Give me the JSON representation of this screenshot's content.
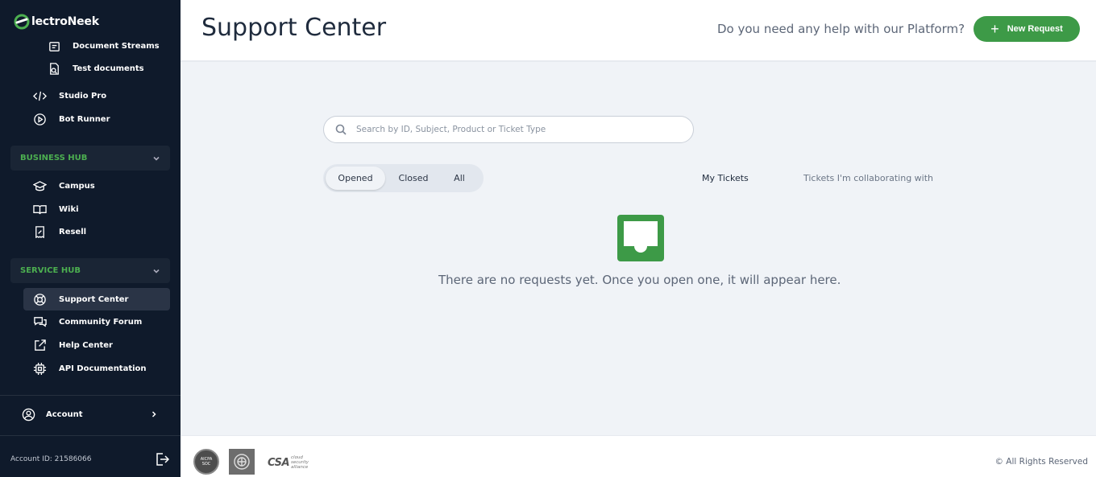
{
  "brand": {
    "logo_text": "lectroNeek",
    "accent": "#3d9a47"
  },
  "sidebar": {
    "items_top": [
      {
        "label": "Document Streams",
        "icon": "document-stream-icon"
      },
      {
        "label": "Test documents",
        "icon": "test-document-icon"
      },
      {
        "label": "Studio Pro",
        "icon": "code-icon"
      },
      {
        "label": "Bot Runner",
        "icon": "play-circle-icon"
      }
    ],
    "business_hub": {
      "label": "BUSINESS HUB",
      "items": [
        {
          "label": "Campus",
          "icon": "graduation-cap-icon"
        },
        {
          "label": "Wiki",
          "icon": "book-icon"
        },
        {
          "label": "Resell",
          "icon": "receipt-percent-icon"
        }
      ]
    },
    "service_hub": {
      "label": "SERVICE HUB",
      "items": [
        {
          "label": "Support Center",
          "icon": "lifebuoy-icon"
        },
        {
          "label": "Community Forum",
          "icon": "chat-bubbles-icon"
        },
        {
          "label": "Help Center",
          "icon": "external-link-icon"
        },
        {
          "label": "API Documentation",
          "icon": "chip-icon"
        }
      ]
    },
    "account": {
      "label": "Account",
      "icon": "user-circle-icon"
    },
    "account_id": "Account ID: 21586066"
  },
  "header": {
    "title": "Support Center",
    "help_question": "Do you need any help with our Platform?",
    "new_request_label": "New Request"
  },
  "main": {
    "search_placeholder": "Search by ID, Subject, Product or Ticket Type",
    "status_filters": [
      "Opened",
      "Closed",
      "All"
    ],
    "selected_filter": "Opened",
    "ticket_tabs": [
      "My Tickets",
      "Tickets I'm collaborating with"
    ],
    "empty_message": "There are no requests yet. Once you open one, it will appear here."
  },
  "footer": {
    "badge_aicpa_line1": "AICPA",
    "badge_aicpa_line2": "SOC",
    "badge_csa": "CSA",
    "badge_csa_sub": "cloud security alliance",
    "copyright": "© All Rights Reserved"
  }
}
